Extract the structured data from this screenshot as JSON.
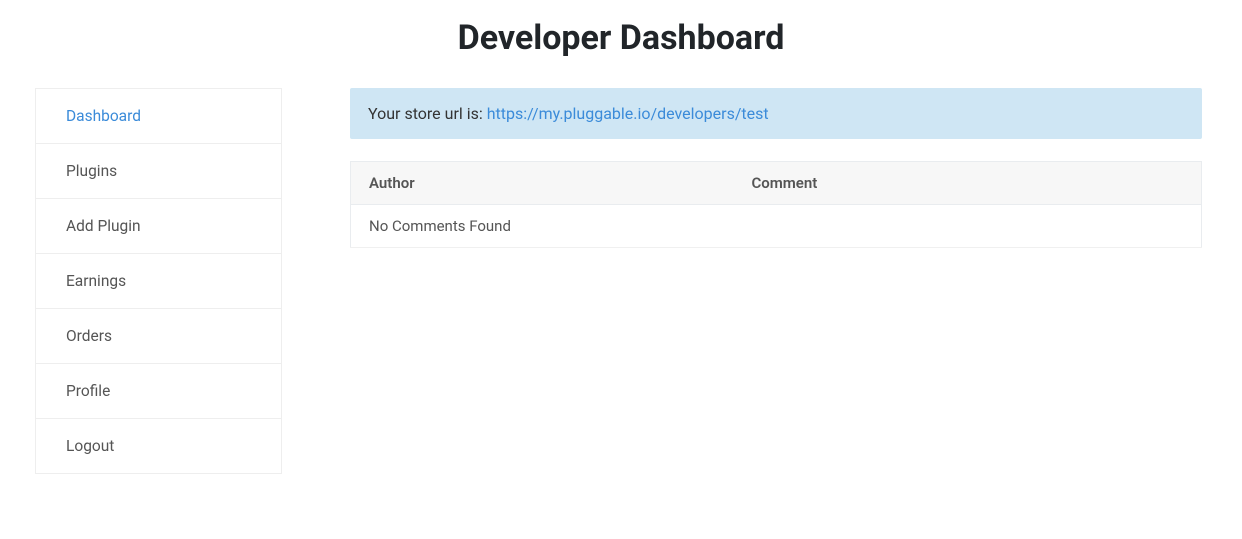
{
  "header": {
    "title": "Developer Dashboard"
  },
  "sidebar": {
    "items": [
      {
        "label": "Dashboard",
        "active": true
      },
      {
        "label": "Plugins",
        "active": false
      },
      {
        "label": "Add Plugin",
        "active": false
      },
      {
        "label": "Earnings",
        "active": false
      },
      {
        "label": "Orders",
        "active": false
      },
      {
        "label": "Profile",
        "active": false
      },
      {
        "label": "Logout",
        "active": false
      }
    ]
  },
  "main": {
    "store_url_prefix": "Your store url is: ",
    "store_url": "https://my.pluggable.io/developers/test",
    "table": {
      "headers": [
        "Author",
        "Comment"
      ],
      "empty_message": "No Comments Found"
    }
  }
}
